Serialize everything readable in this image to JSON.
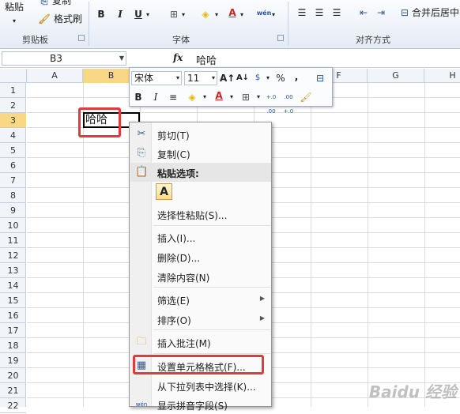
{
  "ribbon": {
    "paste_label": "粘贴",
    "copy_label": "复制",
    "format_painter_label": "格式刷",
    "clipboard_group": "剪贴板",
    "font_group": "字体",
    "align_group": "对齐方式",
    "merge_label": "合并后居中",
    "bold": "B",
    "italic": "I",
    "underline": "U"
  },
  "formula_bar": {
    "name_box": "B3",
    "fx": "fx",
    "value": "哈哈"
  },
  "columns": [
    "A",
    "B",
    "C",
    "D",
    "E",
    "F",
    "G",
    "H"
  ],
  "selected_column": "B",
  "rows": [
    "1",
    "2",
    "3",
    "4",
    "5",
    "6",
    "7",
    "8",
    "9",
    "10",
    "11",
    "12",
    "13",
    "14",
    "15",
    "16",
    "17",
    "18",
    "19",
    "20",
    "21",
    "22"
  ],
  "selected_row": "3",
  "cell_b3": "哈哈",
  "mini_toolbar": {
    "font": "宋体",
    "size": "11",
    "percent": "%",
    "comma": ",",
    "bold": "B",
    "italic": "I",
    "dec_inc": "+.0 .00",
    "dec_dec": ".00 +.0"
  },
  "context_menu": {
    "cut": "剪切(T)",
    "copy": "复制(C)",
    "paste_options": "粘贴选项:",
    "paste_a": "A",
    "paste_special": "选择性粘贴(S)...",
    "insert": "插入(I)...",
    "delete": "删除(D)...",
    "clear": "清除内容(N)",
    "filter": "筛选(E)",
    "sort": "排序(O)",
    "insert_comment": "插入批注(M)",
    "format_cells": "设置单元格格式(F)...",
    "pick_list": "从下拉列表中选择(K)...",
    "phonetic": "显示拼音字段(S)"
  },
  "watermark": "Baidu 经验",
  "colors": {
    "highlight_red": "#e03a3a",
    "selected_header": "#f8d884",
    "font_color_red": "#e02020"
  }
}
